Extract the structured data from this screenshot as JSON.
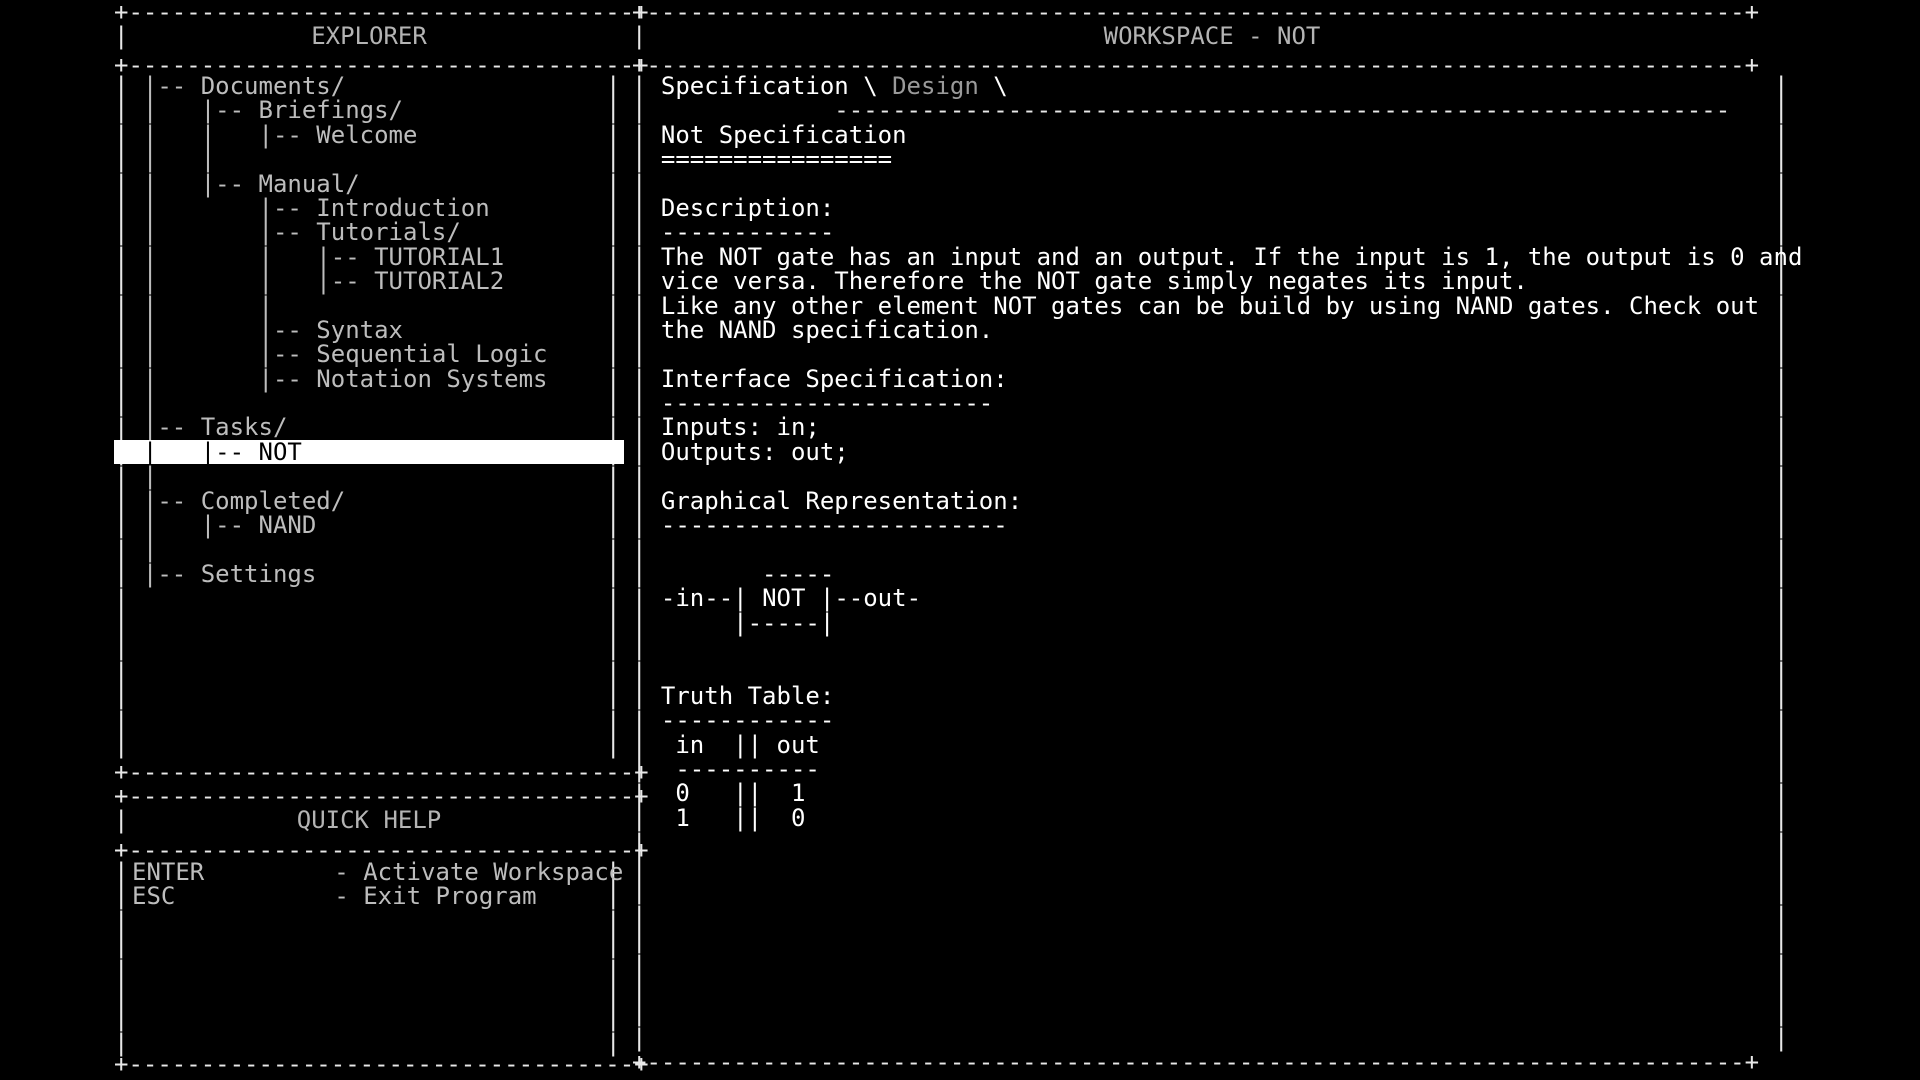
{
  "explorer": {
    "title": "EXPLORER",
    "tree": [
      {
        "prefix": "  |-- ",
        "label": "Documents/",
        "indent": 0,
        "selected": false,
        "type": "folder"
      },
      {
        "prefix": "  |   |-- ",
        "label": "Briefings/",
        "indent": 1,
        "selected": false,
        "type": "folder"
      },
      {
        "prefix": "  |   |   |-- ",
        "label": "Welcome",
        "indent": 2,
        "selected": false,
        "type": "file"
      },
      {
        "prefix": "  |   |",
        "label": "",
        "indent": 1,
        "selected": false,
        "type": "spacer"
      },
      {
        "prefix": "  |   |-- ",
        "label": "Manual/",
        "indent": 1,
        "selected": false,
        "type": "folder"
      },
      {
        "prefix": "  |       |-- ",
        "label": "Introduction",
        "indent": 2,
        "selected": false,
        "type": "file"
      },
      {
        "prefix": "  |       |-- ",
        "label": "Tutorials/",
        "indent": 2,
        "selected": false,
        "type": "folder"
      },
      {
        "prefix": "  |       |   |-- ",
        "label": "TUTORIAL1",
        "indent": 3,
        "selected": false,
        "type": "file"
      },
      {
        "prefix": "  |       |   |-- ",
        "label": "TUTORIAL2",
        "indent": 3,
        "selected": false,
        "type": "file"
      },
      {
        "prefix": "  |       |",
        "label": "",
        "indent": 2,
        "selected": false,
        "type": "spacer"
      },
      {
        "prefix": "  |       |-- ",
        "label": "Syntax",
        "indent": 2,
        "selected": false,
        "type": "file"
      },
      {
        "prefix": "  |       |-- ",
        "label": "Sequential Logic",
        "indent": 2,
        "selected": false,
        "type": "file"
      },
      {
        "prefix": "  |       |-- ",
        "label": "Notation Systems",
        "indent": 2,
        "selected": false,
        "type": "file"
      },
      {
        "prefix": "  |",
        "label": "",
        "indent": 0,
        "selected": false,
        "type": "spacer"
      },
      {
        "prefix": "  |-- ",
        "label": "Tasks/",
        "indent": 0,
        "selected": false,
        "type": "folder"
      },
      {
        "prefix": "  |   |-- ",
        "label": "NOT",
        "indent": 1,
        "selected": true,
        "type": "file"
      },
      {
        "prefix": "  |",
        "label": "",
        "indent": 0,
        "selected": false,
        "type": "spacer"
      },
      {
        "prefix": "  |-- ",
        "label": "Completed/",
        "indent": 0,
        "selected": false,
        "type": "folder"
      },
      {
        "prefix": "  |   |-- ",
        "label": "NAND",
        "indent": 1,
        "selected": false,
        "type": "file"
      },
      {
        "prefix": "  |",
        "label": "",
        "indent": 0,
        "selected": false,
        "type": "spacer"
      },
      {
        "prefix": "  |-- ",
        "label": "Settings",
        "indent": 0,
        "selected": false,
        "type": "file"
      }
    ],
    "selected_item": "NOT"
  },
  "quick_help": {
    "title": "QUICK HELP",
    "bindings": [
      {
        "key": "ENTER",
        "dash": "-",
        "action": "Activate Workspace"
      },
      {
        "key": "ESC",
        "dash": "-",
        "action": "Exit Program"
      }
    ]
  },
  "workspace": {
    "title": "WORKSPACE - NOT",
    "tabs": [
      {
        "label": "Specification",
        "active": true
      },
      {
        "label": "Design",
        "active": false
      }
    ],
    "tab_separator": "\\",
    "doc": {
      "heading": "Not Specification",
      "heading_rule": "================",
      "sections": [
        {
          "title": "Description:",
          "rule": "------------",
          "lines": [
            "The NOT gate has an input and an output. If the input is 1, the output is 0 and",
            "vice versa. Therefore the NOT gate simply negates its input.",
            "Like any other element NOT gates can be build by using NAND gates. Check out",
            "the NAND specification."
          ]
        },
        {
          "title": "Interface Specification:",
          "rule": "-----------------------",
          "lines": [
            "Inputs: in;",
            "Outputs: out;"
          ]
        },
        {
          "title": "Graphical Representation:",
          "rule": "------------------------",
          "lines": []
        }
      ],
      "gate_diagram": {
        "input_wire": "-in--",
        "output_wire": "--out-",
        "gate_label": "NOT",
        "top_rule": "-----",
        "bottom_rule": "-----"
      },
      "truth_table": {
        "title": "Truth Table:",
        "rule": "------------",
        "header": " in  || out",
        "header_rule": " ----------",
        "rows": [
          {
            "in": "0",
            "sep": "||",
            "out": "1"
          },
          {
            "in": "1",
            "sep": "||",
            "out": "0"
          }
        ]
      }
    }
  },
  "colors": {
    "background": "#000000",
    "foreground": "#c8c8c8",
    "bright": "#ffffff",
    "dim": "#9a9a9a",
    "selection_bg": "#ffffff",
    "selection_fg": "#000000"
  }
}
